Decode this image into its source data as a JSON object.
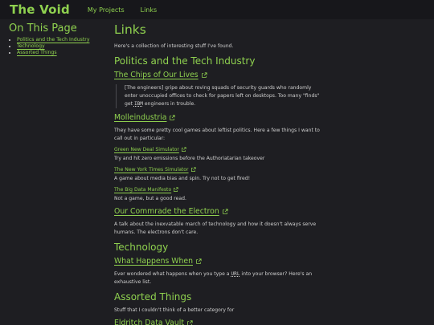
{
  "nav": {
    "site_title": "The Void",
    "links": [
      "My Projects",
      "Links"
    ]
  },
  "sidebar": {
    "title": "On This Page",
    "items": [
      "Politics and the Tech Industry",
      "Technology",
      "Assorted Things"
    ]
  },
  "main": {
    "title": "Links",
    "intro": "Here's a collection of interesting stuff I've found.",
    "section_politics": {
      "heading": "Politics and the Tech Industry",
      "chips": {
        "title": "The Chips of Our Lives",
        "quote_before": "[The engineers] gripe about roving squads of security guards who randomly enter unoccupied offices to check for papers left on desktops. Too many \"finds\" get ",
        "quote_abbr": "IBM",
        "quote_after": " engineers in trouble."
      },
      "molle": {
        "title": "Molleindustria",
        "desc": "They have some pretty cool games about leftist politics. Here a few things I want to call out in particular:",
        "games": [
          {
            "title": "Green New Deal Simulator",
            "desc": "Try and hit zero emissions before the Authoriatarian takeover"
          },
          {
            "title": "The New York Times Simulator",
            "desc": "A game about media bias and spin. Try not to get fired!"
          },
          {
            "title": "The Big Data Manifesto",
            "desc": "Not a game, but a good read."
          }
        ]
      },
      "electron": {
        "title": "Our Commrade the Electron",
        "desc": "A talk about the inexvatable march of technology and how it doesn't always serve humans. The electrons don't care."
      }
    },
    "section_tech": {
      "heading": "Technology",
      "what": {
        "title": "What Happens When",
        "desc_before": "Ever wondered what happens when you type a ",
        "desc_abbr": "URL",
        "desc_after": " into your browser? Here's an exhaustive list."
      }
    },
    "section_assorted": {
      "heading": "Assorted Things",
      "desc": "Stuff that I couldn't think of a better category for",
      "eldritch": {
        "title": "Eldritch Data Vault"
      }
    }
  },
  "colors": {
    "background": "#1e1e22",
    "topbar": "#17171b",
    "accent": "#8fd14f",
    "text": "#d6d6d6"
  },
  "icons": {
    "external_link": "external-link-icon"
  }
}
